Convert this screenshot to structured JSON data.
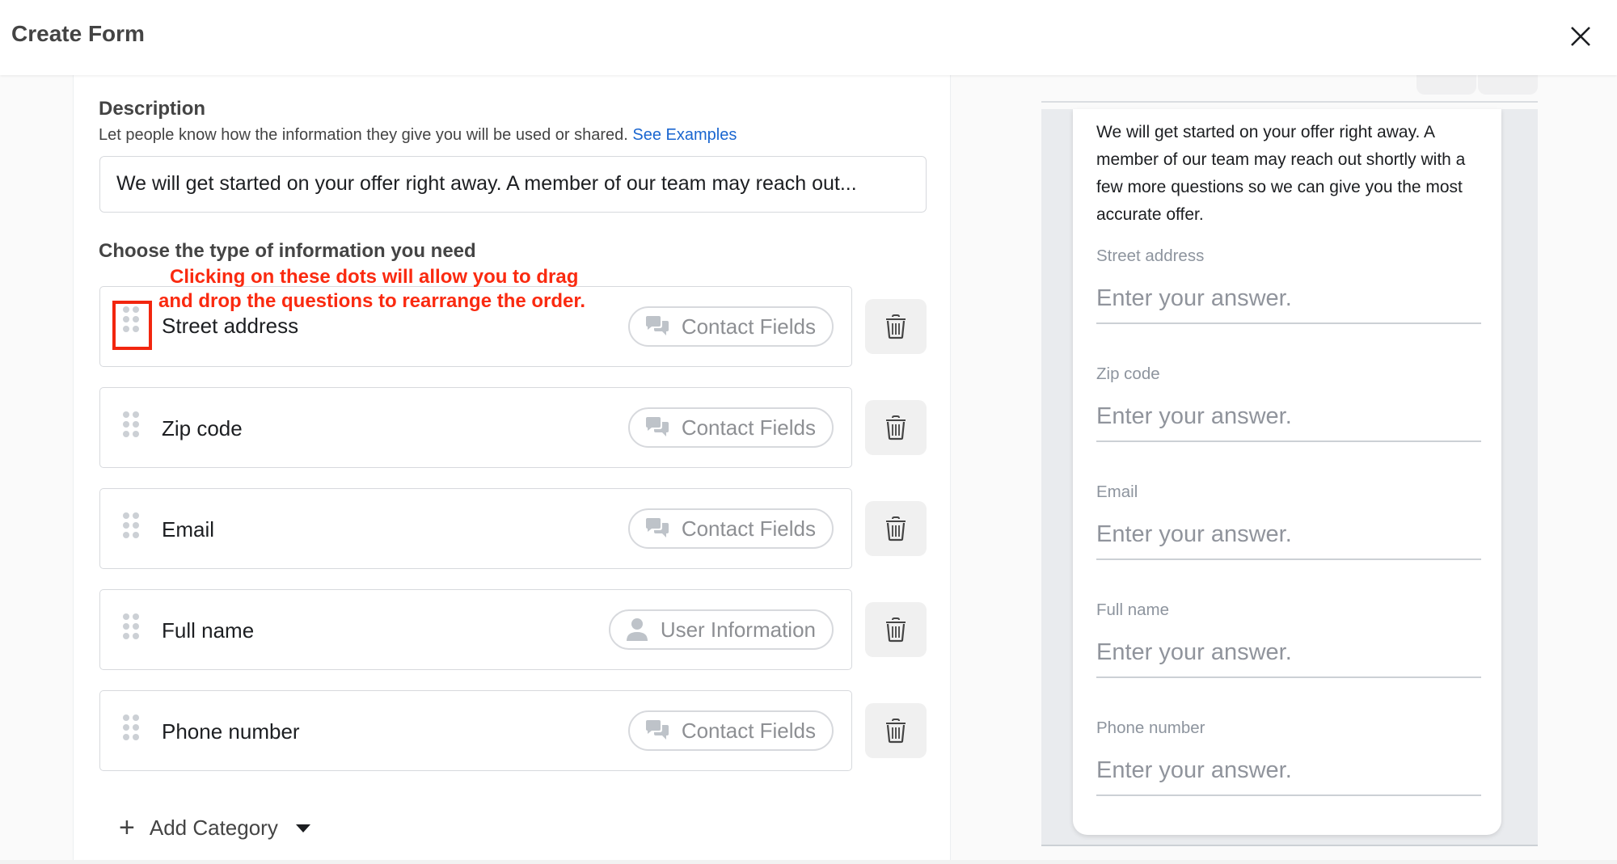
{
  "header": {
    "title": "Create Form",
    "close_icon": "close-icon"
  },
  "description": {
    "label": "Description",
    "help_text": "Let people know how the information they give you will be used or shared.",
    "help_link": "See Examples",
    "value": "We will get started on your offer right away. A member of our team may reach out..."
  },
  "questions": {
    "heading": "Choose the type of information you need",
    "items": [
      {
        "label": "Street address",
        "category": "Contact Fields",
        "category_icon": "chat-bubbles-icon"
      },
      {
        "label": "Zip code",
        "category": "Contact Fields",
        "category_icon": "chat-bubbles-icon"
      },
      {
        "label": "Email",
        "category": "Contact Fields",
        "category_icon": "chat-bubbles-icon"
      },
      {
        "label": "Full name",
        "category": "User Information",
        "category_icon": "person-icon"
      },
      {
        "label": "Phone number",
        "category": "Contact Fields",
        "category_icon": "chat-bubbles-icon"
      }
    ],
    "add_category_label": "Add Category"
  },
  "annotation": {
    "line1": "Clicking on these dots will allow you to drag",
    "line2": "and drop the questions to rearrange the order.",
    "color": "#fa2a10"
  },
  "preview": {
    "intro": "We will get started on your offer right away. A member of our team may reach out shortly with a few more questions so we can give you the most accurate offer.",
    "placeholder": "Enter your answer.",
    "fields": [
      "Street address",
      "Zip code",
      "Email",
      "Full name",
      "Phone number"
    ]
  },
  "colors": {
    "link": "#1a66d0",
    "annotation": "#fa2a10",
    "preview_bg": "#e9ebee"
  }
}
